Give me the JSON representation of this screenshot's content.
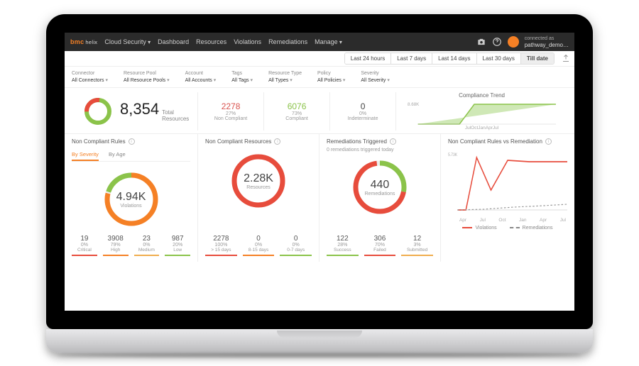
{
  "brand": {
    "name": "bmc",
    "sub": "helix"
  },
  "nav": [
    {
      "label": "Cloud Security",
      "caret": true
    },
    {
      "label": "Dashboard",
      "caret": false
    },
    {
      "label": "Resources",
      "caret": false
    },
    {
      "label": "Violations",
      "caret": false
    },
    {
      "label": "Remediations",
      "caret": false
    },
    {
      "label": "Manage",
      "caret": true
    }
  ],
  "user": {
    "label": "connected as",
    "name": "pathway_demo…"
  },
  "time_tabs": [
    "Last 24 hours",
    "Last 7 days",
    "Last 14 days",
    "Last 30 days",
    "Till date"
  ],
  "time_active": 4,
  "filters": [
    {
      "label": "Connector",
      "value": "All Connectors"
    },
    {
      "label": "Resource Pool",
      "value": "All Resource Pools"
    },
    {
      "label": "Account",
      "value": "All Accounts"
    },
    {
      "label": "Tags",
      "value": "All Tags"
    },
    {
      "label": "Resource Type",
      "value": "All Types"
    },
    {
      "label": "Policy",
      "value": "All Policies"
    },
    {
      "label": "Severity",
      "value": "All Severity"
    }
  ],
  "summary": {
    "total_num": "8,354",
    "total_label": "Total Resources",
    "noncomp": {
      "n": "2278",
      "p": "27%",
      "t": "Non Compliant"
    },
    "comp": {
      "n": "6076",
      "p": "73%",
      "t": "Compliant"
    },
    "indet": {
      "n": "0",
      "p": "0%",
      "t": "Indeterminate"
    },
    "trend_title": "Compliance Trend",
    "trend_yaxis": "8.68K",
    "trend_months": [
      "Jul",
      "Oct",
      "Jan",
      "Apr",
      "Jul"
    ]
  },
  "panels": {
    "rules": {
      "title": "Non Compliant Rules",
      "tabs": [
        "By Severity",
        "By Age"
      ],
      "gauge": {
        "big": "4.94K",
        "sm": "Violations"
      },
      "stats": [
        {
          "n": "19",
          "p": "0%",
          "t": "Critical",
          "bar": "red"
        },
        {
          "n": "3908",
          "p": "79%",
          "t": "High",
          "bar": "orange"
        },
        {
          "n": "23",
          "p": "0%",
          "t": "Medium",
          "bar": "amber"
        },
        {
          "n": "987",
          "p": "20%",
          "t": "Low",
          "bar": "green"
        }
      ]
    },
    "resources": {
      "title": "Non Compliant Resources",
      "gauge": {
        "big": "2.28K",
        "sm": "Resources"
      },
      "stats": [
        {
          "n": "2278",
          "p": "100%",
          "t": "> 15 days",
          "bar": "red"
        },
        {
          "n": "0",
          "p": "0%",
          "t": "8-15 days",
          "bar": "orange"
        },
        {
          "n": "0",
          "p": "0%",
          "t": "0-7 days",
          "bar": "green"
        }
      ]
    },
    "remed": {
      "title": "Remediations Triggered",
      "note": "0 remediations triggered today",
      "gauge": {
        "big": "440",
        "sm": "Remediations"
      },
      "stats": [
        {
          "n": "122",
          "p": "28%",
          "t": "Success",
          "bar": "green"
        },
        {
          "n": "306",
          "p": "70%",
          "t": "Failed",
          "bar": "red"
        },
        {
          "n": "12",
          "p": "3%",
          "t": "Submitted",
          "bar": "amber"
        }
      ]
    },
    "trend": {
      "title": "Non Compliant Rules vs Remediation",
      "yaxis": "5.73K",
      "months": [
        "Apr",
        "Jul",
        "Oct",
        "Jan",
        "Apr",
        "Jul"
      ],
      "legend": [
        "Violations",
        "Remediations"
      ]
    }
  },
  "chart_data": [
    {
      "type": "area",
      "title": "Compliance Trend",
      "x": [
        "Jul",
        "Oct",
        "Jan",
        "Apr",
        "Jul"
      ],
      "series": [
        {
          "name": "Resources",
          "values": [
            0,
            0,
            8200,
            8354,
            8354
          ]
        }
      ],
      "ylim": [
        0,
        8680
      ],
      "ylabel": "",
      "xlabel": ""
    },
    {
      "type": "pie",
      "title": "Total Resources compliance",
      "categories": [
        "Non Compliant",
        "Compliant",
        "Indeterminate"
      ],
      "values": [
        2278,
        6076,
        0
      ]
    },
    {
      "type": "pie",
      "title": "Non Compliant Rules by Severity",
      "categories": [
        "Critical",
        "High",
        "Medium",
        "Low"
      ],
      "values": [
        19,
        3908,
        23,
        987
      ]
    },
    {
      "type": "pie",
      "title": "Non Compliant Resources by Age",
      "categories": [
        "> 15 days",
        "8-15 days",
        "0-7 days"
      ],
      "values": [
        2278,
        0,
        0
      ]
    },
    {
      "type": "pie",
      "title": "Remediations Triggered",
      "categories": [
        "Success",
        "Failed",
        "Submitted"
      ],
      "values": [
        122,
        306,
        12
      ]
    },
    {
      "type": "line",
      "title": "Non Compliant Rules vs Remediation",
      "x": [
        "Apr",
        "Jul",
        "Oct",
        "Jan",
        "Apr",
        "Jul"
      ],
      "series": [
        {
          "name": "Violations",
          "values": [
            0,
            5200,
            2800,
            4900,
            4900,
            4937
          ]
        },
        {
          "name": "Remediations",
          "values": [
            0,
            50,
            120,
            260,
            380,
            440
          ]
        }
      ],
      "ylim": [
        0,
        5730
      ],
      "ylabel": "",
      "xlabel": ""
    }
  ]
}
